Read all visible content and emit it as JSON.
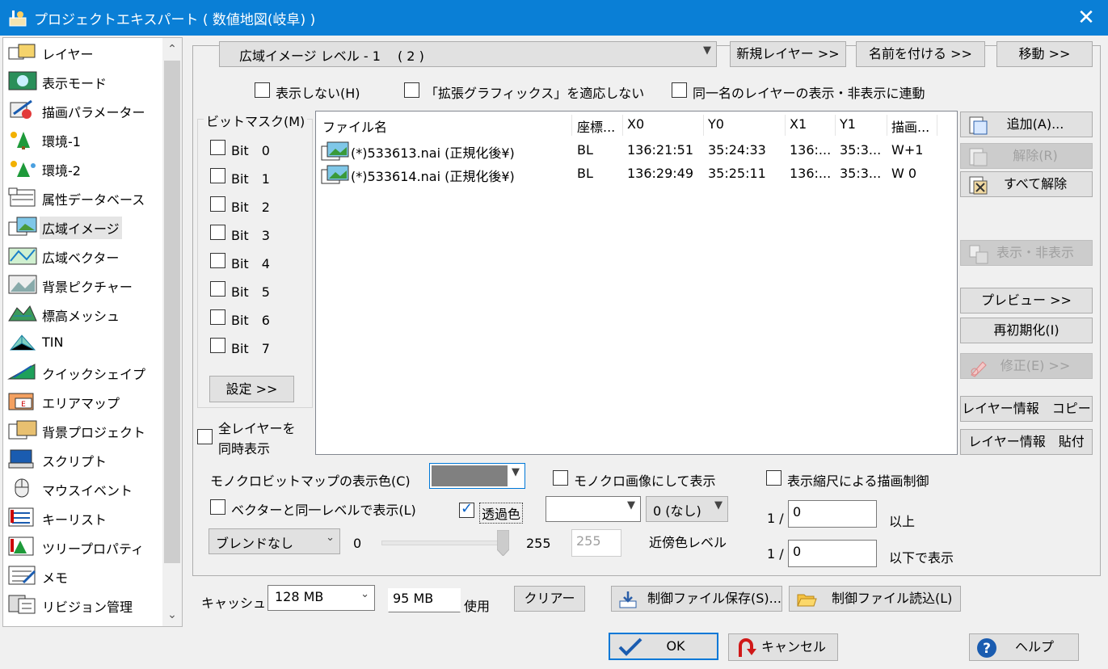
{
  "window": {
    "title": "プロジェクトエキスパート ( 数値地図(岐阜) )",
    "close_glyph": "✕"
  },
  "nav": {
    "items": [
      {
        "label": "レイヤー"
      },
      {
        "label": "表示モード"
      },
      {
        "label": "描画パラメーター"
      },
      {
        "label": "環境-1"
      },
      {
        "label": "環境-2"
      },
      {
        "label": "属性データベース"
      },
      {
        "label": "広域イメージ",
        "selected": true
      },
      {
        "label": "広域ベクター"
      },
      {
        "label": "背景ピクチャー"
      },
      {
        "label": "標高メッシュ"
      },
      {
        "label": "TIN"
      },
      {
        "label": "クイックシェイプ"
      },
      {
        "label": "エリアマップ"
      },
      {
        "label": "背景プロジェクト"
      },
      {
        "label": "スクリプト"
      },
      {
        "label": "マウスイベント"
      },
      {
        "label": "キーリスト"
      },
      {
        "label": "ツリープロパティ"
      },
      {
        "label": "メモ"
      },
      {
        "label": "リビジョン管理"
      }
    ],
    "scroll_up": "⌃",
    "scroll_down": "⌄"
  },
  "top": {
    "layer_select": "広域イメージ レベル - 1　 ( 2 )",
    "new_layer": "新規レイヤー >>",
    "rename": "名前を付ける >>",
    "move": "移動 >>"
  },
  "options": {
    "hide": "表示しない(H)",
    "no_ext_graphics": "「拡張グラフィックス」を適応しない",
    "link_same_name": "同一名のレイヤーの表示・非表示に連動"
  },
  "bitmask": {
    "title": "ビットマスク(M)",
    "bits": [
      "Bit　0",
      "Bit　1",
      "Bit　2",
      "Bit　3",
      "Bit　4",
      "Bit　5",
      "Bit　6",
      "Bit　7"
    ],
    "set_button": "設定 >>"
  },
  "all_layers": {
    "line1": "全レイヤーを",
    "line2": "同時表示"
  },
  "files": {
    "columns": [
      "ファイル名",
      "座標...",
      "X0",
      "Y0",
      "X1",
      "Y1",
      "描画..."
    ],
    "rows": [
      {
        "name": "(*)533613.nai (正規化後¥)",
        "coord": "BL",
        "x0": "136:21:51",
        "y0": "35:24:33",
        "x1": "136:...",
        "y1": "35:3...",
        "draw": "W+1"
      },
      {
        "name": "(*)533614.nai (正規化後¥)",
        "coord": "BL",
        "x0": "136:29:49",
        "y0": "35:25:11",
        "x1": "136:...",
        "y1": "35:3...",
        "draw": "W 0"
      }
    ]
  },
  "side_buttons": {
    "add": "追加(A)...",
    "remove": "解除(R)",
    "remove_all": "すべて解除",
    "show_hide": "表示・非表示",
    "preview": "プレビュー >>",
    "reinit": "再初期化(I)",
    "edit": "修正(E) >>",
    "copy_info": "レイヤー情報　コピー",
    "paste_info": "レイヤー情報　貼付"
  },
  "display": {
    "mono_color_label": "モノクロビットマップの表示色(C)",
    "mono_color_swatch": "#808080",
    "mono_image": "モノクロ画像にして表示",
    "scale_control": "表示縮尺による描画制御",
    "same_level_vector": "ベクターと同一レベルで表示(L)",
    "transparent": "透過色",
    "transparent_checked": true,
    "near_color_value": "0 (なし)",
    "near_color_label": "近傍色レベル",
    "blend": "ブレンドなし",
    "slider_min": "0",
    "slider_max": "255",
    "slider_value_field": "255",
    "slider_level": 1.0,
    "scale_prefix1": "1 /",
    "scale_min": "0",
    "scale_suffix1": "以上",
    "scale_prefix2": "1 /",
    "scale_max": "0",
    "scale_suffix2": "以下で表示"
  },
  "bottom": {
    "cache_label": "キャッシュ",
    "cache_size": "128 MB",
    "cache_used": "95 MB",
    "used_label": "使用",
    "clear": "クリアー",
    "save_ctrl": "制御ファイル保存(S)...",
    "load_ctrl": "制御ファイル読込(L)"
  },
  "footer": {
    "ok": "OK",
    "cancel": "キャンセル",
    "help": "ヘルプ"
  },
  "colors": {
    "titlebar": "#0a7fd6",
    "accent": "#0078d7"
  }
}
